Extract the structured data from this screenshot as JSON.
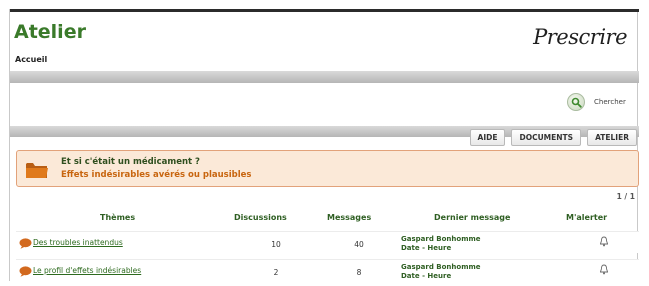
{
  "header": {
    "title": "Atelier",
    "breadcrumb": "Accueil",
    "logo_text": "Prescrire"
  },
  "search": {
    "label": "Chercher",
    "icon": "search-icon"
  },
  "tabs": [
    {
      "label": "AIDE"
    },
    {
      "label": "DOCUMENTS"
    },
    {
      "label": "ATELIER"
    }
  ],
  "topic": {
    "title": "Et si c'était un médicament ?",
    "subtitle": "Effets indésirables avérés ou plausibles",
    "icon": "folder-icon"
  },
  "pagination": "1 / 1",
  "table": {
    "headers": {
      "themes": "Thèmes",
      "discussions": "Discussions",
      "messages": "Messages",
      "last_message": "Dernier message",
      "alert": "M'alerter"
    },
    "rows": [
      {
        "theme": "Des troubles inattendus",
        "discussions": "10",
        "messages": "40",
        "last_author": "Gaspard Bonhomme",
        "last_date": "Date - Heure"
      },
      {
        "theme": "Le profil d'effets indésirables",
        "discussions": "2",
        "messages": "8",
        "last_author": "Gaspard Bonhomme",
        "last_date": "Date - Heure"
      }
    ]
  },
  "colors": {
    "title_green": "#3a7a2a",
    "topic_bg": "#fbe9d8",
    "topic_border": "#e2a27a",
    "accent_orange": "#c8650f"
  }
}
